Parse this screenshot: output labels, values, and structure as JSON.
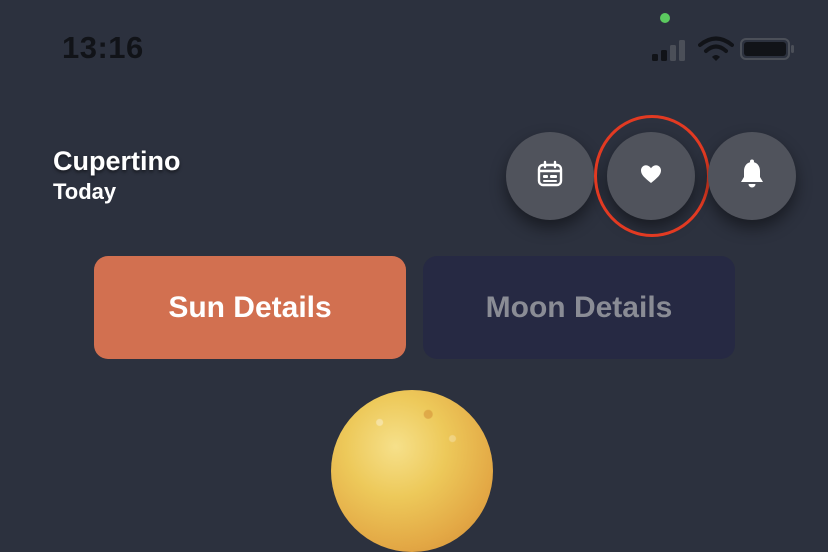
{
  "status_bar": {
    "time": "13:16"
  },
  "location": {
    "city": "Cupertino",
    "day": "Today"
  },
  "actions": [
    {
      "icon": "calendar-icon"
    },
    {
      "icon": "heart-icon",
      "highlighted": true
    },
    {
      "icon": "bell-icon"
    }
  ],
  "tabs": {
    "sun_label": "Sun Details",
    "moon_label": "Moon Details",
    "selected": "Sun Details"
  },
  "colors": {
    "background": "#2c313e",
    "sun_tab": "#d27050",
    "moon_tab": "#262943",
    "button": "#50535c",
    "highlight_ring": "#e23a22"
  }
}
